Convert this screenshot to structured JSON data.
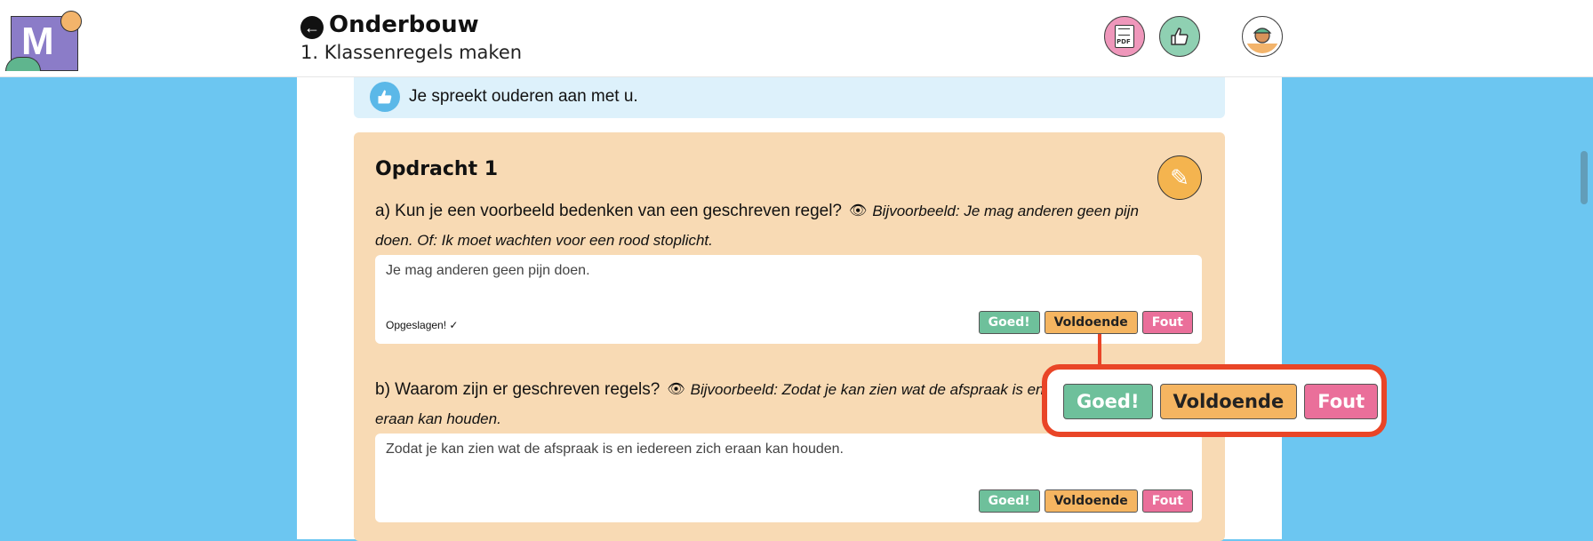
{
  "header": {
    "title": "Onderbouw",
    "subtitle": "1. Klassenregels maken",
    "back_icon": "arrow-left-icon",
    "actions": [
      {
        "name": "pdf",
        "icon": "pdf-icon",
        "label": "PDF"
      },
      {
        "name": "thumbs-up",
        "icon": "thumbs-up-icon"
      },
      {
        "name": "profile",
        "icon": "avatar-icon"
      }
    ]
  },
  "logo": {
    "letter": "M"
  },
  "tip": {
    "text": "Je spreekt ouderen aan met u."
  },
  "assignment": {
    "title": "Opdracht 1",
    "questions": [
      {
        "question": "a) Kun je een voorbeeld bedenken van een geschreven regel?",
        "example": "Bijvoorbeeld: Je mag anderen geen pijn doen. Of: Ik moet wachten voor een rood stoplicht.",
        "answer": "Je mag anderen geen pijn doen.",
        "status": "Opgeslagen! ✓"
      },
      {
        "question": "b) Waarom zijn er geschreven regels?",
        "example": "Bijvoorbeeld: Zodat je kan zien wat de afspraak is en iedereen zich eraan kan houden.",
        "answer": "Zodat je kan zien wat de afspraak is en iedereen zich eraan kan houden."
      }
    ],
    "grades": {
      "good": "Goed!",
      "ok": "Voldoende",
      "wrong": "Fout"
    }
  },
  "colors": {
    "background": "#6cc6f1",
    "assignment_bg": "#f8dab4",
    "tip_bg": "#ddf1fb",
    "good": "#6ec09b",
    "ok": "#f5b561",
    "wrong": "#ea6f9a",
    "callout": "#e94527"
  }
}
